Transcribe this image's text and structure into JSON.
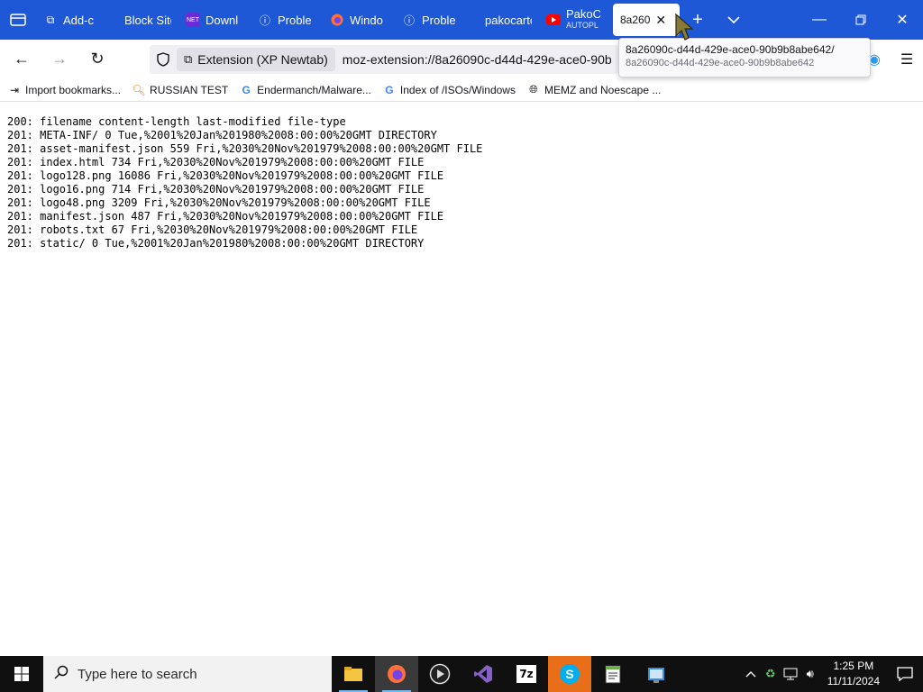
{
  "tabs": [
    {
      "label": "Add-c",
      "icon": "puzzle-icon",
      "active": false
    },
    {
      "label": "Block Site",
      "icon": "",
      "active": false
    },
    {
      "label": "Downl",
      "icon": "net-icon",
      "active": false
    },
    {
      "label": "Proble",
      "icon": "info-icon",
      "active": false
    },
    {
      "label": "Windo",
      "icon": "firefox-icon",
      "active": false
    },
    {
      "label": "Proble",
      "icon": "info-icon",
      "active": false
    },
    {
      "label": "pakocarto",
      "icon": "",
      "active": false
    },
    {
      "label": "PakoC",
      "sublabel": "AUTOPL",
      "icon": "youtube-icon",
      "active": false
    },
    {
      "label": "8a260",
      "icon": "",
      "active": true
    }
  ],
  "navbar": {
    "identity_label": "Extension (XP Newtab)",
    "url": "moz-extension://8a26090c-d44d-429e-ace0-90b"
  },
  "tooltip": {
    "line1": "8a26090c-d44d-429e-ace0-90b9b8abe642/",
    "line2": "8a26090c-d44d-429e-ace0-90b9b8abe642"
  },
  "bookmarks": [
    {
      "label": "Import bookmarks...",
      "icon": "import-icon"
    },
    {
      "label": "RUSSIAN TEST",
      "icon": "search-icon"
    },
    {
      "label": "Endermanch/Malware...",
      "icon": "google-icon"
    },
    {
      "label": "Index of /ISOs/Windows",
      "icon": "google-icon"
    },
    {
      "label": "MEMZ and Noescape ...",
      "icon": "globe-icon"
    }
  ],
  "listing": [
    "200: filename content-length last-modified file-type",
    "201: META-INF/ 0 Tue,%2001%20Jan%201980%2008:00:00%20GMT DIRECTORY",
    "201: asset-manifest.json 559 Fri,%2030%20Nov%201979%2008:00:00%20GMT FILE",
    "201: index.html 734 Fri,%2030%20Nov%201979%2008:00:00%20GMT FILE",
    "201: logo128.png 16086 Fri,%2030%20Nov%201979%2008:00:00%20GMT FILE",
    "201: logo16.png 714 Fri,%2030%20Nov%201979%2008:00:00%20GMT FILE",
    "201: logo48.png 3209 Fri,%2030%20Nov%201979%2008:00:00%20GMT FILE",
    "201: manifest.json 487 Fri,%2030%20Nov%201979%2008:00:00%20GMT FILE",
    "201: robots.txt 67 Fri,%2030%20Nov%201979%2008:00:00%20GMT FILE",
    "201: static/ 0 Tue,%2001%20Jan%201980%2008:00:00%20GMT DIRECTORY"
  ],
  "taskbar": {
    "search_placeholder": "Type here to search",
    "time": "1:25 PM",
    "date": "11/11/2024",
    "apps": [
      "file-explorer-icon",
      "firefox-icon",
      "media-player-icon",
      "visual-studio-icon",
      "7zip-icon",
      "skype-icon",
      "notepad-icon",
      "control-panel-icon"
    ]
  },
  "colors": {
    "tabstrip": "#1f58d6",
    "taskbar": "#101010"
  }
}
